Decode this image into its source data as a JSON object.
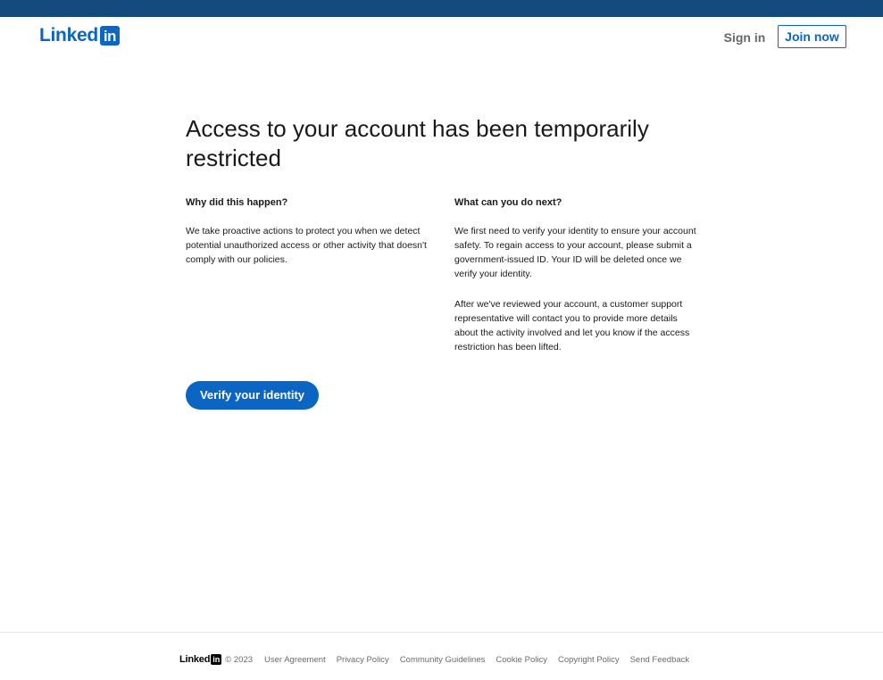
{
  "header": {
    "logo_word": "Linked",
    "logo_box": "in",
    "signin_label": "Sign in",
    "join_label": "Join now"
  },
  "main": {
    "title": "Access to your account has been temporarily restricted",
    "why": {
      "heading": "Why did this happen?",
      "paragraphs": [
        "We take proactive actions to protect you when we detect potential unauthorized access or other activity that doesn't comply with our policies."
      ]
    },
    "next": {
      "heading": "What can you do next?",
      "paragraphs": [
        "We first need to verify your identity to ensure your account safety. To regain access to your account, please submit a government-issued ID. Your ID will be deleted once we verify your identity.",
        "After we've reviewed your account, a customer support representative will contact you to provide more details about the activity involved and let you know if the access restriction has been lifted."
      ]
    },
    "verify_label": "Verify your identity"
  },
  "footer": {
    "logo_word": "Linked",
    "logo_box": "in",
    "copyright": "© 2023",
    "links": [
      "User Agreement",
      "Privacy Policy",
      "Community Guidelines",
      "Cookie Policy",
      "Copyright Policy",
      "Send Feedback"
    ]
  },
  "colors": {
    "topbar": "#134b7e",
    "brand": "#0a66c2"
  }
}
